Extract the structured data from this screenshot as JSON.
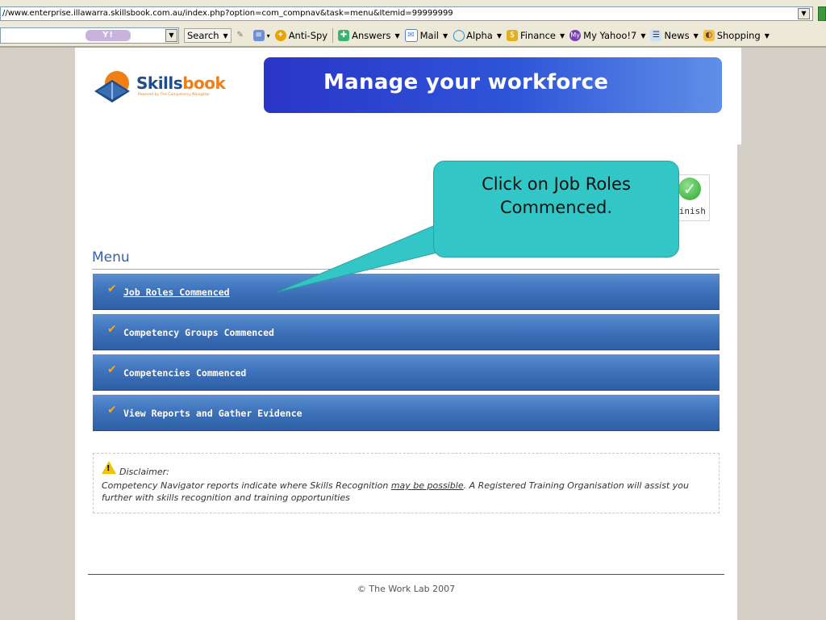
{
  "browser": {
    "url": "//www.enterprise.illawarra.skillsbook.com.au/index.php?option=com_compnav&task=menu&Itemid=99999999",
    "toolbar": {
      "search_logo": "Y!",
      "items": [
        {
          "label": "Search",
          "icon": "magnifier-icon",
          "caret": true
        },
        {
          "label": "",
          "icon": "pencil-icon",
          "caret": false
        },
        {
          "label": "",
          "icon": "highlight-icon",
          "caret": true
        },
        {
          "label": "Anti-Spy",
          "icon": "antispy-icon",
          "caret": false
        },
        {
          "label": "Answers",
          "icon": "answers-icon",
          "caret": true
        },
        {
          "label": "Mail",
          "icon": "mail-icon",
          "caret": true
        },
        {
          "label": "Alpha",
          "icon": "alpha-icon",
          "caret": true
        },
        {
          "label": "Finance",
          "icon": "finance-icon",
          "caret": true
        },
        {
          "label": "My Yahoo!7",
          "icon": "myyahoo-icon",
          "caret": true
        },
        {
          "label": "News",
          "icon": "news-icon",
          "caret": true
        },
        {
          "label": "Shopping",
          "icon": "shopping-icon",
          "caret": true
        }
      ]
    }
  },
  "site": {
    "logo": {
      "part1": "Skills",
      "part2": "book",
      "tagline": "Powered by The Competency Navigator"
    },
    "banner": "Manage your workforce",
    "finish_label": "Finish",
    "menu_title": "Menu",
    "menu_items": [
      {
        "label": " Job Roles Commenced",
        "linked": true
      },
      {
        "label": "Competency Groups Commenced",
        "linked": false
      },
      {
        "label": "Competencies Commenced",
        "linked": false
      },
      {
        "label": "View Reports and Gather Evidence",
        "linked": false
      }
    ],
    "disclaimer": {
      "title": "Disclaimer:",
      "text_before": "Competency Navigator reports indicate where Skills Recognition ",
      "text_link": "may be possible",
      "text_after": ". A Registered Training Organisation will assist you further with skills recognition and training opportunities"
    },
    "footer": "© The Work Lab 2007"
  },
  "callout": {
    "text_line1": "Click on Job Roles",
    "text_line2": "Commenced."
  },
  "colors": {
    "accent": "#33c6c6",
    "menu_blue": "#3f73bb",
    "brand_orange": "#f07f16"
  }
}
